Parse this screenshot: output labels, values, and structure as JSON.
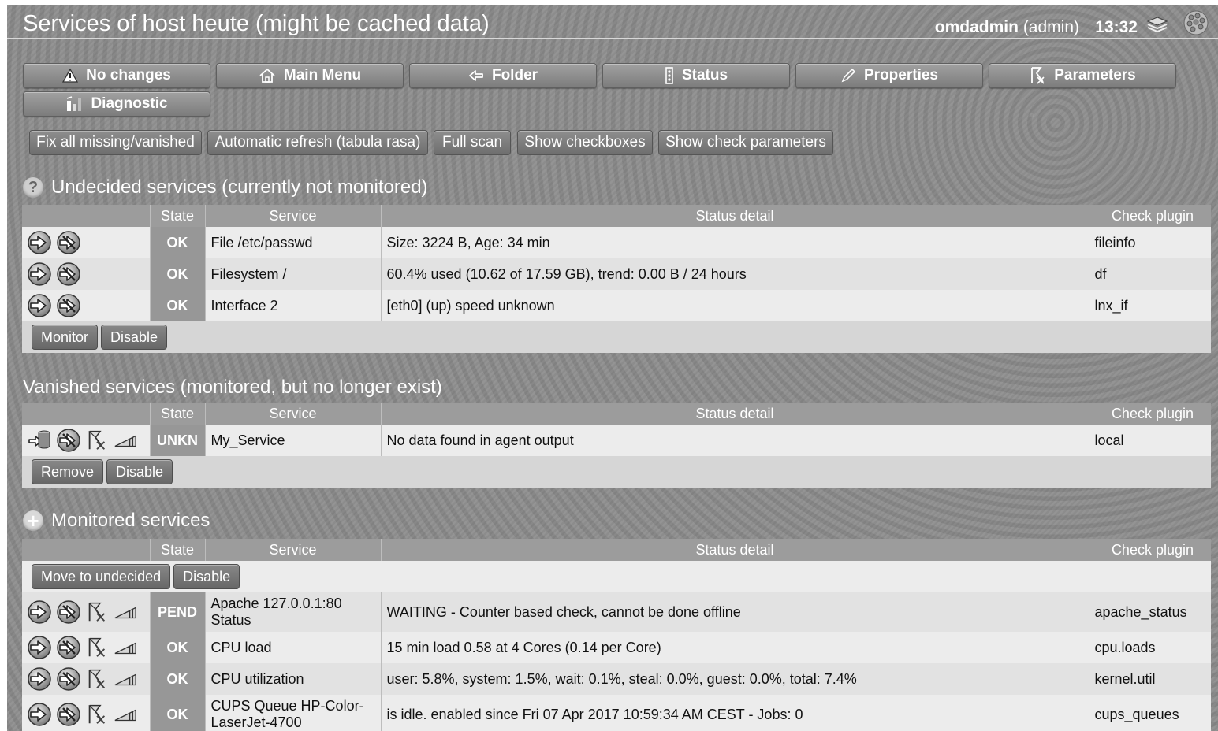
{
  "header": {
    "title": "Services of host heute (might be cached data)",
    "user": "omdadmin",
    "role": "(admin)",
    "time": "13:32"
  },
  "context_buttons": [
    {
      "label": "No changes",
      "icon": "warning-icon"
    },
    {
      "label": "Main Menu",
      "icon": "home-icon"
    },
    {
      "label": "Folder",
      "icon": "back-arrow-icon"
    },
    {
      "label": "Status",
      "icon": "status-icon"
    },
    {
      "label": "Properties",
      "icon": "pencil-icon"
    },
    {
      "label": "Parameters",
      "icon": "parameters-icon"
    },
    {
      "label": "Diagnostic",
      "icon": "diagnostic-icon"
    }
  ],
  "actions": [
    "Fix all missing/vanished",
    "Automatic refresh (tabula rasa)",
    "Full scan",
    "Show checkboxes",
    "Show check parameters"
  ],
  "columns": {
    "state": "State",
    "service": "Service",
    "detail": "Status detail",
    "plugin": "Check plugin"
  },
  "undecided": {
    "title": "Undecided services (currently not monitored)",
    "rows": [
      {
        "state": "OK",
        "service": "File /etc/passwd",
        "detail": "Size: 3224 B, Age: 34 min",
        "plugin": "fileinfo"
      },
      {
        "state": "OK",
        "service": "Filesystem /",
        "detail": "60.4% used (10.62 of 17.59 GB), trend: 0.00 B / 24 hours",
        "plugin": "df"
      },
      {
        "state": "OK",
        "service": "Interface 2",
        "detail": "[eth0] (up) speed unknown",
        "plugin": "lnx_if"
      }
    ],
    "buttons": [
      "Monitor",
      "Disable"
    ]
  },
  "vanished": {
    "title": "Vanished services (monitored, but no longer exist)",
    "rows": [
      {
        "state": "UNKN",
        "service": "My_Service",
        "detail": "No data found in agent output",
        "plugin": "local"
      }
    ],
    "buttons": [
      "Remove",
      "Disable"
    ]
  },
  "monitored": {
    "title": "Monitored services",
    "buttons": [
      "Move to undecided",
      "Disable"
    ],
    "rows": [
      {
        "state": "PEND",
        "service_line1": "Apache 127.0.0.1:80",
        "service_line2": "Status",
        "detail": "WAITING - Counter based check, cannot be done offline",
        "plugin": "apache_status"
      },
      {
        "state": "OK",
        "service": "CPU load",
        "detail": "15 min load 0.58 at 4 Cores (0.14 per Core)",
        "plugin": "cpu.loads"
      },
      {
        "state": "OK",
        "service": "CPU utilization",
        "detail": "user: 5.8%, system: 1.5%, wait: 0.1%, steal: 0.0%, guest: 0.0%, total: 7.4%",
        "plugin": "kernel.util"
      },
      {
        "state": "OK",
        "service_line1": "CUPS Queue HP-Color-",
        "service_line2": "LaserJet-4700",
        "detail": "is idle. enabled since Fri 07 Apr 2017 10:59:34 AM CEST - Jobs: 0",
        "plugin": "cups_queues"
      }
    ]
  }
}
